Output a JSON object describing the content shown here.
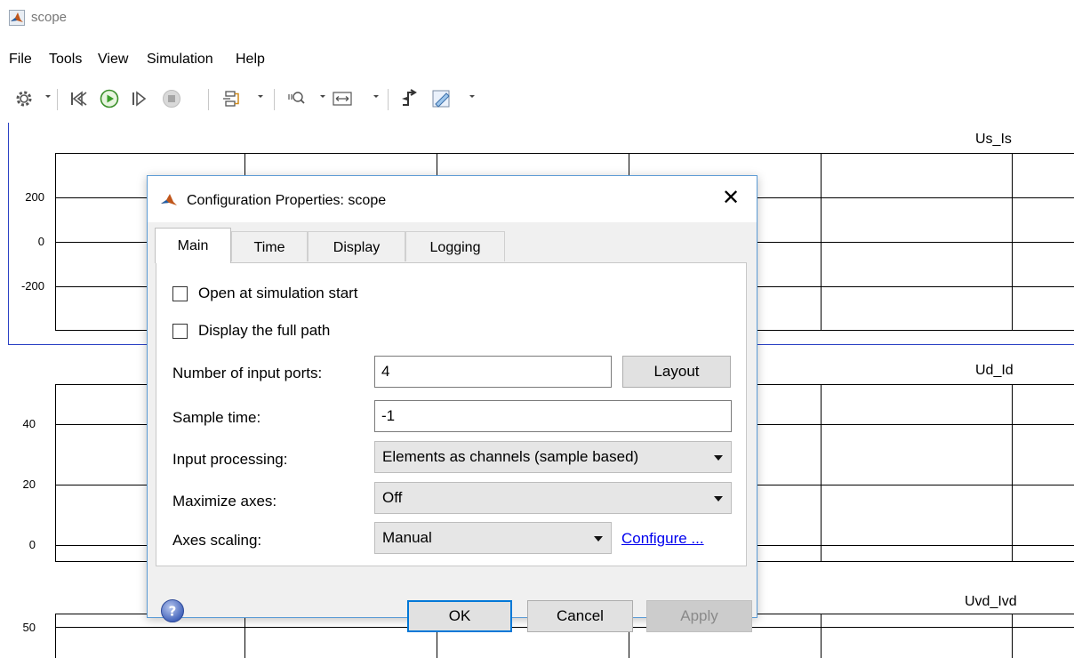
{
  "window": {
    "title": "scope",
    "icon": "matlab-icon"
  },
  "menu": {
    "items": [
      "File",
      "Tools",
      "View",
      "Simulation",
      "Help"
    ]
  },
  "toolbar": {
    "icons": [
      "gear-icon",
      "step-back-icon",
      "run-icon",
      "step-forward-icon",
      "stop-icon",
      "signal-select-icon",
      "zoom-icon",
      "scale-axes-icon",
      "triggers-icon",
      "measurements-icon"
    ]
  },
  "scope": {
    "axes": [
      {
        "title": "Us_Is",
        "ticks": [
          "200",
          "0",
          "-200"
        ]
      },
      {
        "title": "Ud_Id",
        "ticks": [
          "40",
          "20",
          "0"
        ]
      },
      {
        "title": "Uvd_Ivd",
        "ticks": [
          "50"
        ]
      }
    ]
  },
  "dialog": {
    "title": "Configuration Properties: scope",
    "close_glyph": "✕",
    "tabs": [
      "Main",
      "Time",
      "Display",
      "Logging"
    ],
    "active_tab": "Main",
    "open_at_start_label": "Open at simulation start",
    "open_at_start_checked": false,
    "display_full_path_label": "Display the full path",
    "display_full_path_checked": false,
    "input_ports_label": "Number of input ports:",
    "input_ports_value": "4",
    "layout_button": "Layout",
    "sample_time_label": "Sample time:",
    "sample_time_value": "-1",
    "input_processing_label": "Input processing:",
    "input_processing_value": "Elements as channels (sample based)",
    "maximize_axes_label": "Maximize axes:",
    "maximize_axes_value": "Off",
    "axes_scaling_label": "Axes scaling:",
    "axes_scaling_value": "Manual",
    "configure_link": "Configure ...",
    "ok_button": "OK",
    "cancel_button": "Cancel",
    "apply_button": "Apply"
  },
  "colors": {
    "accent": "#0078d7",
    "active_axes_frame": "#2b41c4",
    "link": "#0000ee"
  }
}
